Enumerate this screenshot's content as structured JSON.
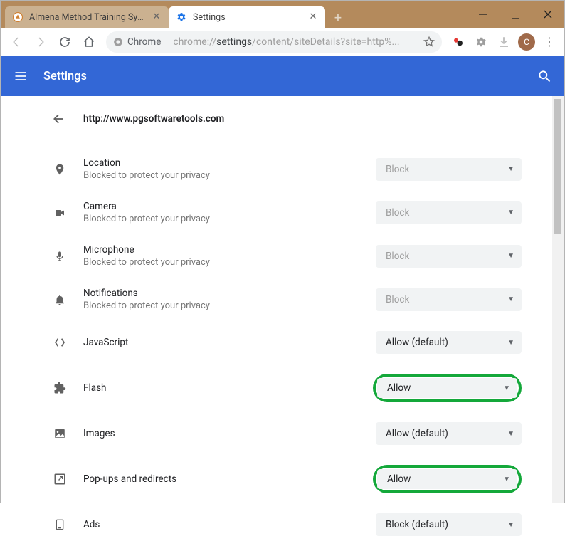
{
  "window": {
    "tabs": [
      {
        "title": "Almena Method Training Systems",
        "active": false
      },
      {
        "title": "Settings",
        "active": true
      }
    ]
  },
  "toolbar": {
    "chrome_chip": "Chrome",
    "url_prefix": "chrome://",
    "url_bold": "settings",
    "url_rest": "/content/siteDetails?site=http%...",
    "avatar_letter": "C"
  },
  "settings_header": {
    "title": "Settings"
  },
  "page": {
    "site_url": "http://www.pgsoftwaretools.com"
  },
  "permissions": [
    {
      "key": "location",
      "name": "Location",
      "sub": "Blocked to protect your privacy",
      "value": "Block",
      "disabled": true,
      "highlight": false
    },
    {
      "key": "camera",
      "name": "Camera",
      "sub": "Blocked to protect your privacy",
      "value": "Block",
      "disabled": true,
      "highlight": false
    },
    {
      "key": "microphone",
      "name": "Microphone",
      "sub": "Blocked to protect your privacy",
      "value": "Block",
      "disabled": true,
      "highlight": false
    },
    {
      "key": "notifications",
      "name": "Notifications",
      "sub": "Blocked to protect your privacy",
      "value": "Block",
      "disabled": true,
      "highlight": false
    },
    {
      "key": "javascript",
      "name": "JavaScript",
      "sub": "",
      "value": "Allow (default)",
      "disabled": false,
      "highlight": false
    },
    {
      "key": "flash",
      "name": "Flash",
      "sub": "",
      "value": "Allow",
      "disabled": false,
      "highlight": true
    },
    {
      "key": "images",
      "name": "Images",
      "sub": "",
      "value": "Allow (default)",
      "disabled": false,
      "highlight": false
    },
    {
      "key": "popups",
      "name": "Pop-ups and redirects",
      "sub": "",
      "value": "Allow",
      "disabled": false,
      "highlight": true
    },
    {
      "key": "ads",
      "name": "Ads",
      "sub": "",
      "value": "Block (default)",
      "disabled": false,
      "highlight": false
    }
  ]
}
